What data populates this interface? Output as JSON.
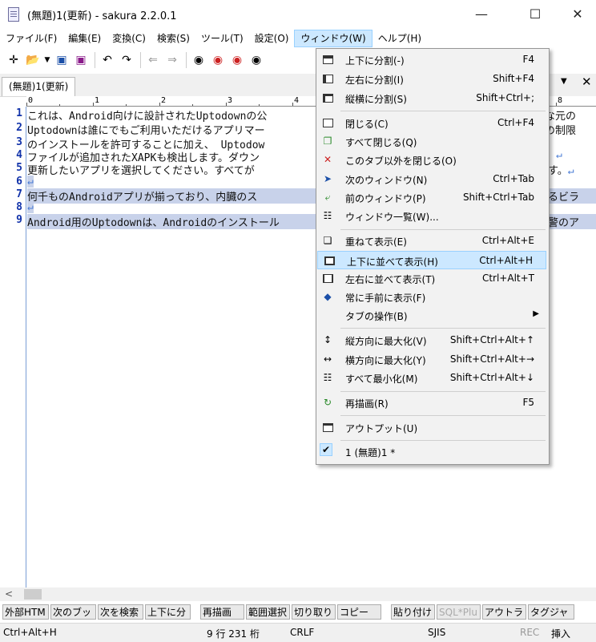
{
  "window": {
    "title": "(無題)1(更新) - sakura 2.2.0.1"
  },
  "menubar": [
    "ファイル(F)",
    "編集(E)",
    "変換(C)",
    "検索(S)",
    "ツール(T)",
    "設定(O)",
    "ウィンドウ(W)",
    "ヘルプ(H)"
  ],
  "tab": {
    "label": "(無題)1(更新)"
  },
  "ruler": [
    "0",
    "1",
    "2",
    "3",
    "4",
    "8"
  ],
  "editor": {
    "lines": [
      {
        "num": "1",
        "text": "これは、Android向けに設計されたUptodownの公",
        "tail": "な元の",
        "eol": ""
      },
      {
        "num": "2",
        "text": "Uptodownは誰にでもご利用いただけるアプリマー",
        "tail": "の制限",
        "eol": ""
      },
      {
        "num": "3",
        "text": "のインストールを許可することに加え、 Uptodow",
        "tail": "",
        "eol": ""
      },
      {
        "num": "4",
        "text": "ファイルが追加されたXAPKも検出します。ダウン",
        "tail": "",
        "eol": "↵"
      },
      {
        "num": "5",
        "text": "更新したいアプリを選択してください。すべてが",
        "tail": "す。",
        "eol": "↵"
      },
      {
        "num": "6",
        "text": "",
        "tail": "",
        "eol": "↵"
      },
      {
        "num": "7",
        "text": "何千ものAndroidアプリが揃っており、内臓のス",
        "tail": "るビラ",
        "eol": ""
      },
      {
        "num": "8",
        "text": "",
        "tail": "",
        "eol": "↵"
      },
      {
        "num": "9",
        "text": "Android用のUptodownは、Androidのインストール",
        "tail": "警のア",
        "eol": ""
      }
    ]
  },
  "window_menu": {
    "items": [
      {
        "label": "上下に分割(-)",
        "shortcut": "F4",
        "icon": "split-horizontal-icon"
      },
      {
        "label": "左右に分割(I)",
        "shortcut": "Shift+F4",
        "icon": "split-vertical-icon"
      },
      {
        "label": "縦横に分割(S)",
        "shortcut": "Shift+Ctrl+;",
        "icon": "split-both-icon"
      },
      {
        "label": "閉じる(C)",
        "shortcut": "Ctrl+F4",
        "icon": "close-window-icon"
      },
      {
        "label": "すべて閉じる(Q)",
        "shortcut": "",
        "icon": "close-all-icon"
      },
      {
        "label": "このタブ以外を閉じる(O)",
        "shortcut": "",
        "icon": "close-others-icon"
      },
      {
        "label": "次のウィンドウ(N)",
        "shortcut": "Ctrl+Tab",
        "icon": "next-window-icon"
      },
      {
        "label": "前のウィンドウ(P)",
        "shortcut": "Shift+Ctrl+Tab",
        "icon": "prev-window-icon"
      },
      {
        "label": "ウィンドウ一覧(W)...",
        "shortcut": "",
        "icon": "window-list-icon"
      },
      {
        "label": "重ねて表示(E)",
        "shortcut": "Ctrl+Alt+E",
        "icon": "cascade-icon"
      },
      {
        "label": "上下に並べて表示(H)",
        "shortcut": "Ctrl+Alt+H",
        "icon": "tile-horizontal-icon"
      },
      {
        "label": "左右に並べて表示(T)",
        "shortcut": "Ctrl+Alt+T",
        "icon": "tile-vertical-icon"
      },
      {
        "label": "常に手前に表示(F)",
        "shortcut": "",
        "icon": "pin-icon"
      },
      {
        "label": "タブの操作(B)",
        "shortcut": "",
        "icon": ""
      },
      {
        "label": "縦方向に最大化(V)",
        "shortcut": "Shift+Ctrl+Alt+↑",
        "icon": "maximize-vertical-icon"
      },
      {
        "label": "横方向に最大化(Y)",
        "shortcut": "Shift+Ctrl+Alt+→",
        "icon": "maximize-horizontal-icon"
      },
      {
        "label": "すべて最小化(M)",
        "shortcut": "Shift+Ctrl+Alt+↓",
        "icon": "minimize-all-icon"
      },
      {
        "label": "再描画(R)",
        "shortcut": "F5",
        "icon": "redraw-icon"
      },
      {
        "label": "アウトプット(U)",
        "shortcut": "",
        "icon": "output-icon"
      },
      {
        "label": "1 (無題)1 *",
        "shortcut": "",
        "icon": "check-icon"
      }
    ]
  },
  "fkeys": [
    "外部HTM",
    "次のブッ",
    "次を検索",
    "上下に分",
    "再描画",
    "範囲選択",
    "切り取り",
    "コピー",
    "貼り付け",
    "SQL*Plu",
    "アウトラ",
    "タグジャ"
  ],
  "status": {
    "key": "Ctrl+Alt+H",
    "position": "9 行  231 桁",
    "eol": "CRLF",
    "encoding": "SJIS",
    "rec": "REC",
    "mode": "挿入"
  },
  "colors": {
    "highlight": "#cce8ff",
    "highlight_border": "#99d1ff",
    "line_number": "#1233aa",
    "selection": "#c8d2ea"
  }
}
